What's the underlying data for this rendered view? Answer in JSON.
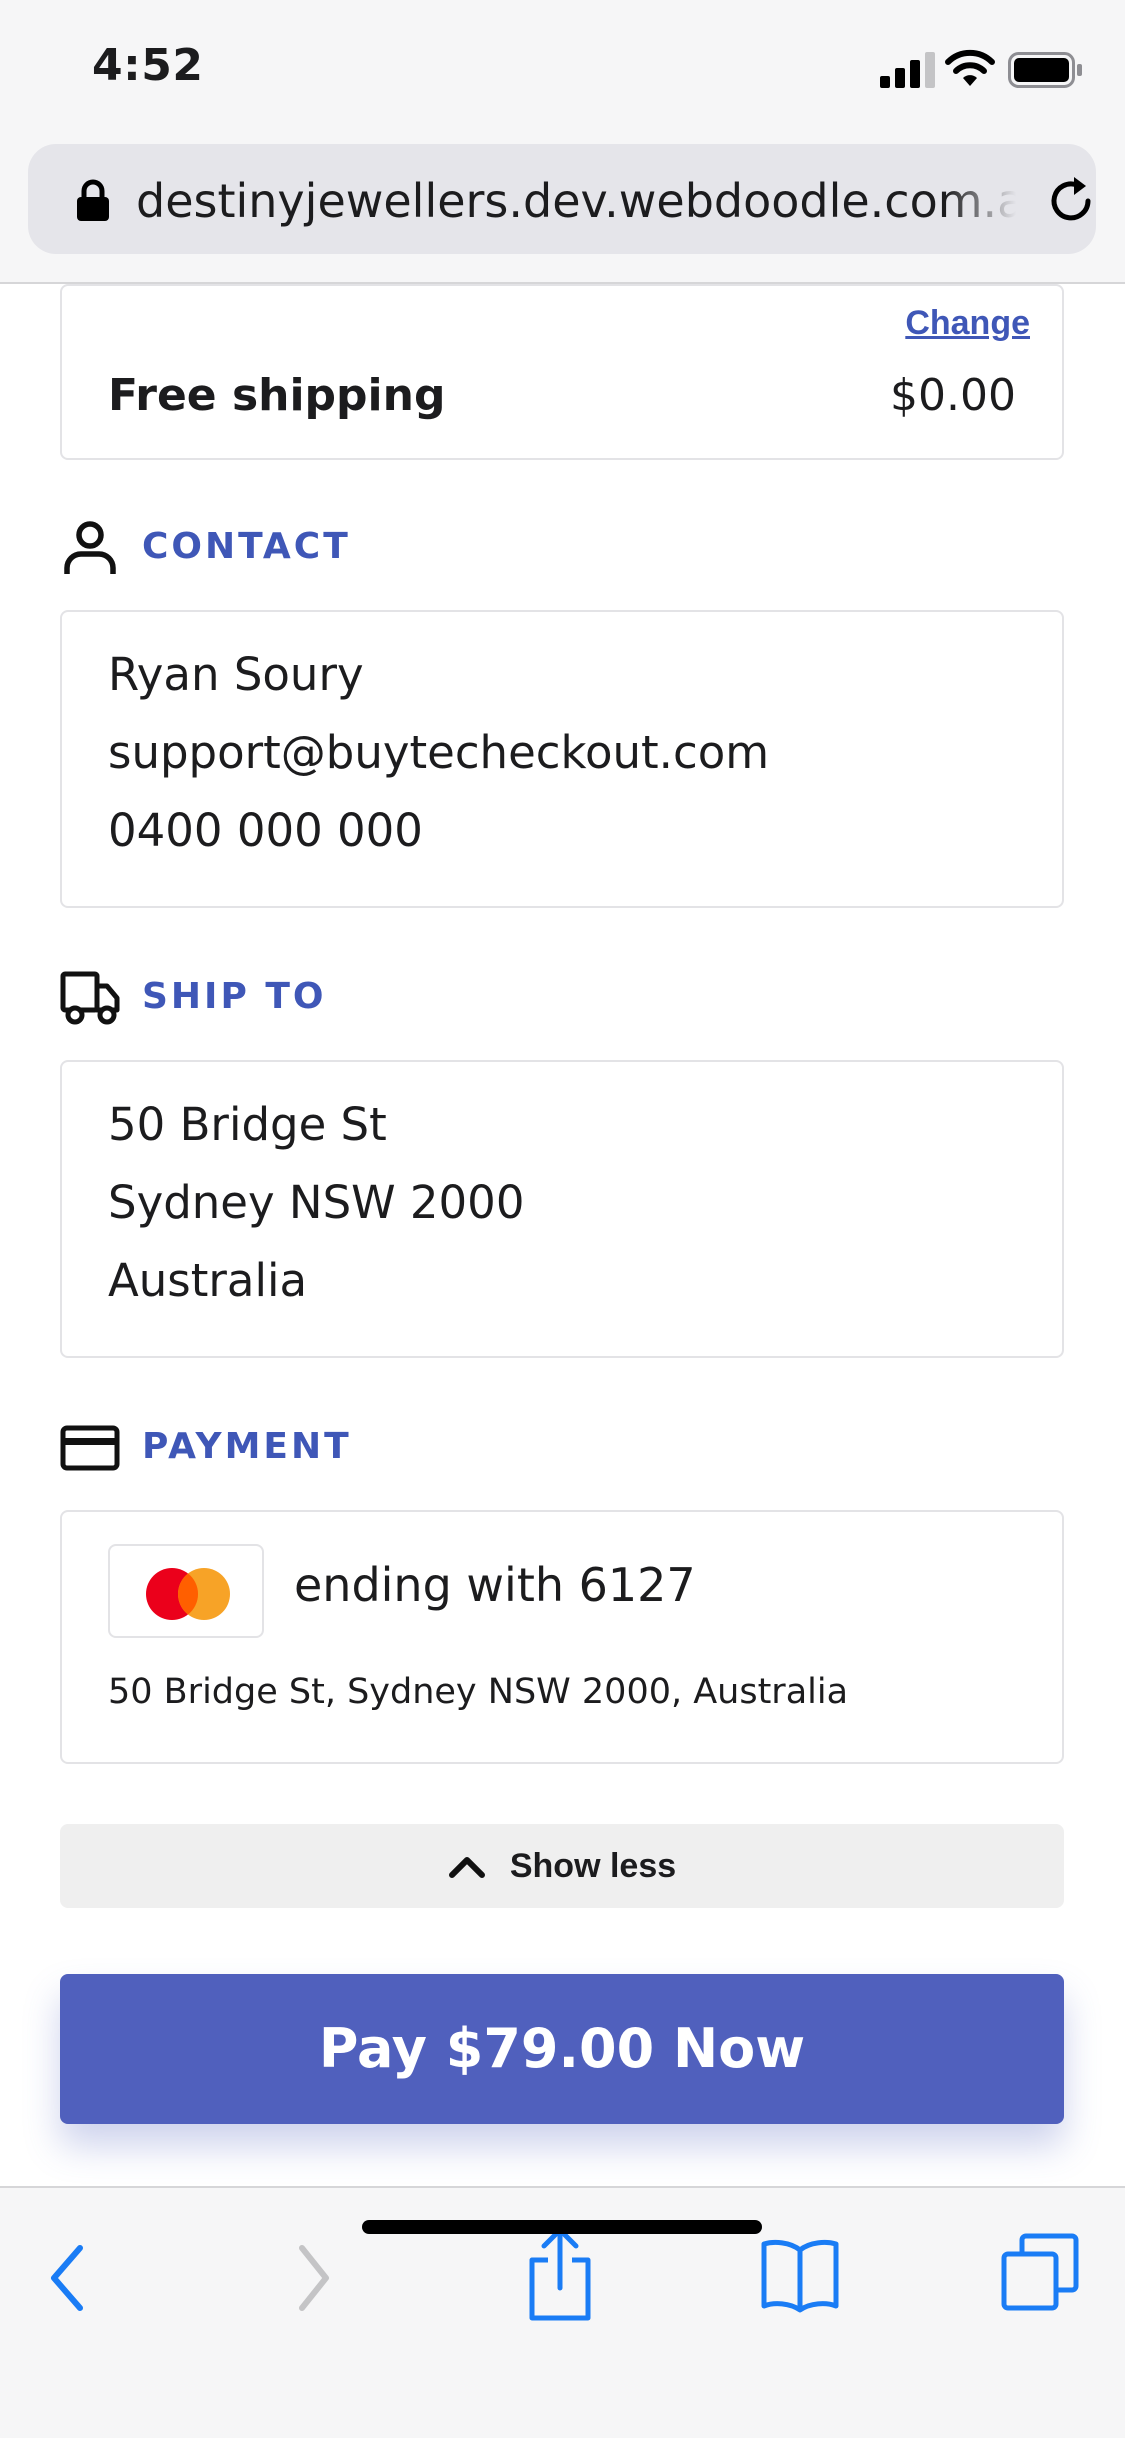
{
  "status_bar": {
    "time": "4:52"
  },
  "browser": {
    "url": "destinyjewellers.dev.webdoodle.com.au"
  },
  "shipping": {
    "change_label": "Change",
    "method": "Free shipping",
    "price": "$0.00"
  },
  "contact": {
    "title": "CONTACT",
    "icon": "person-icon",
    "name": "Ryan Soury",
    "email": "support@buytecheckout.com",
    "phone": "0400 000 000"
  },
  "ship_to": {
    "title": "SHIP TO",
    "icon": "truck-icon",
    "line1": "50 Bridge St",
    "line2": "Sydney NSW 2000",
    "line3": "Australia"
  },
  "payment": {
    "title": "PAYMENT",
    "icon": "credit-card-icon",
    "card_brand": "mastercard",
    "card_text": "ending with 6127",
    "billing_address": "50 Bridge St, Sydney NSW 2000, Australia"
  },
  "show_less_label": "Show less",
  "pay_button_label": "Pay $79.00 Now",
  "colors": {
    "accent": "#3f57b7",
    "pay_button": "#5060bd",
    "safari_blue": "#1a7cf5"
  }
}
